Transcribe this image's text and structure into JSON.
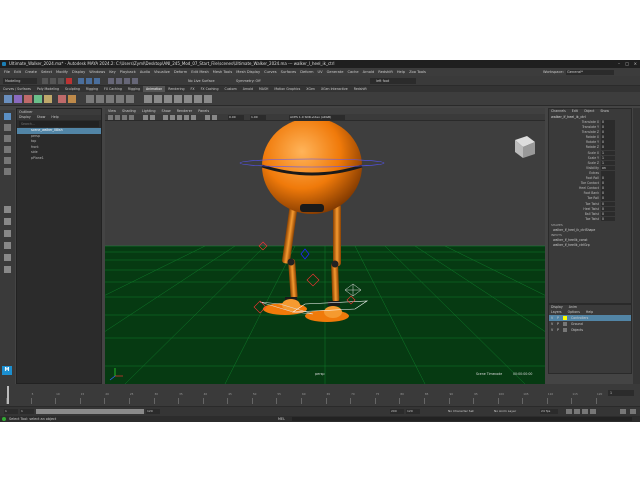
{
  "window": {
    "title": "Ultimate_Walker_2024.ma* - Autodesk MAYA 2024.2: C:\\Users\\Zyml\\Desktop\\ANI_245_Mod_07_Start_File\\scenes\\Ultimate_Walker_2024.ma --- walker_l_heel_ik_ctrl"
  },
  "menubar": {
    "items": [
      "File",
      "Edit",
      "Create",
      "Select",
      "Modify",
      "Display",
      "Windows",
      "Key",
      "Playback",
      "Audio",
      "Visualize",
      "Deform",
      "Edit Mesh",
      "Mesh Tools",
      "Mesh Display",
      "Curves",
      "Surfaces",
      "Deform",
      "UV",
      "Generate",
      "Cache",
      "Arnold",
      "Redshift",
      "Help",
      "Zoo Tools"
    ],
    "workspace_label": "Workspace:",
    "workspace_value": "General*"
  },
  "statusline": {
    "mode": "Modeling",
    "no_live_surface": "No Live Surface",
    "symmetry": "Symmetry: Off",
    "object_field": "left foot"
  },
  "shelf_tabs": [
    "Curves / Surfaces",
    "Poly Modeling",
    "Sculpting",
    "Rigging",
    "FX Caching",
    "Rigging",
    "Animation",
    "Rendering",
    "FX",
    "FX Caching",
    "Custom",
    "Arnold",
    "MASH",
    "Motion Graphics",
    "XGen",
    "XGen Interactive",
    "Redshift"
  ],
  "outliner": {
    "title": "Outliner",
    "menus": [
      "Display",
      "Show",
      "Help"
    ],
    "search_placeholder": "Search...",
    "items": [
      {
        "label": "scene_walker_08ish",
        "selected": true
      },
      {
        "label": "persp",
        "selected": false
      },
      {
        "label": "top",
        "selected": false
      },
      {
        "label": "front",
        "selected": false
      },
      {
        "label": "side",
        "selected": false
      },
      {
        "label": "pPlane1",
        "selected": false
      }
    ]
  },
  "viewport": {
    "menus": [
      "View",
      "Shading",
      "Lighting",
      "Show",
      "Renderer",
      "Panels"
    ],
    "exposure": "0.00",
    "gamma": "1.00",
    "colorspace": "ACES 1.0 SDR-video (sRGB)",
    "camera_label": "persp",
    "timecode_label": "Scene Timecode",
    "timecode_value": "00:00:00:00",
    "colors": {
      "ground": "#063a12",
      "grid": "#12b53a",
      "body": "#f07a0a",
      "stripe": "#5555ff",
      "bg": "#3e3e3e"
    }
  },
  "channels": {
    "menus": [
      "Channels",
      "Edit",
      "Object",
      "Show"
    ],
    "node": "walker_lf_heel_ik_ctrl",
    "attributes": [
      {
        "name": "Translate X",
        "value": "0"
      },
      {
        "name": "Translate Y",
        "value": "0"
      },
      {
        "name": "Translate Z",
        "value": "0"
      },
      {
        "name": "Rotate X",
        "value": "0"
      },
      {
        "name": "Rotate Y",
        "value": "0"
      },
      {
        "name": "Rotate Z",
        "value": "0"
      },
      {
        "name": "Scale X",
        "value": "1"
      },
      {
        "name": "Scale Y",
        "value": "1"
      },
      {
        "name": "Scale Z",
        "value": "1"
      },
      {
        "name": "Visibility",
        "value": "on"
      },
      {
        "name": "Extras",
        "value": ""
      },
      {
        "name": "Foot Roll",
        "value": "0"
      },
      {
        "name": "Toe Contact",
        "value": "0"
      },
      {
        "name": "Heel Contact",
        "value": "0"
      },
      {
        "name": "Foot Bank",
        "value": "0"
      },
      {
        "name": "Toe Roll",
        "value": "0"
      },
      {
        "name": "Toe Twist",
        "value": "0"
      },
      {
        "name": "Heel Twist",
        "value": "0"
      },
      {
        "name": "Ball Twist",
        "value": "0"
      },
      {
        "name": "Toe Twist",
        "value": "0"
      }
    ],
    "shapes_label": "SHAPES",
    "shapes": [
      "walker_lf_heel_ik_ctrlShape"
    ],
    "inputs_label": "INPUTS",
    "inputs": [
      "walker_lf_heelIk_const",
      "walker_lf_heelIk_ctrlGrp"
    ]
  },
  "layers": {
    "menus": [
      "Display",
      "Anim"
    ],
    "submenus": [
      "Layers",
      "Options",
      "Help"
    ],
    "rows": [
      {
        "v": "V",
        "p": "P",
        "name": "Controllers",
        "selected": true
      },
      {
        "v": "V",
        "p": "P",
        "name": "Ground",
        "selected": false
      },
      {
        "v": "V",
        "p": "P",
        "name": "Objects",
        "selected": false
      }
    ]
  },
  "timeline": {
    "ticks": [
      "0",
      "5",
      "10",
      "15",
      "20",
      "25",
      "30",
      "35",
      "40",
      "45",
      "50",
      "55",
      "60",
      "65",
      "70",
      "75",
      "80",
      "85",
      "90",
      "95",
      "100",
      "105",
      "110",
      "115",
      "120"
    ],
    "current_frame": "1",
    "start": "1",
    "range_start": "1",
    "range_end": "120",
    "end": "200",
    "end2": "120",
    "character_set": "No Character Set",
    "anim_layer": "No Anim Layer",
    "fps": "24 fps"
  },
  "helpline": {
    "mel": "MEL",
    "text": "Select Tool: select an object"
  }
}
